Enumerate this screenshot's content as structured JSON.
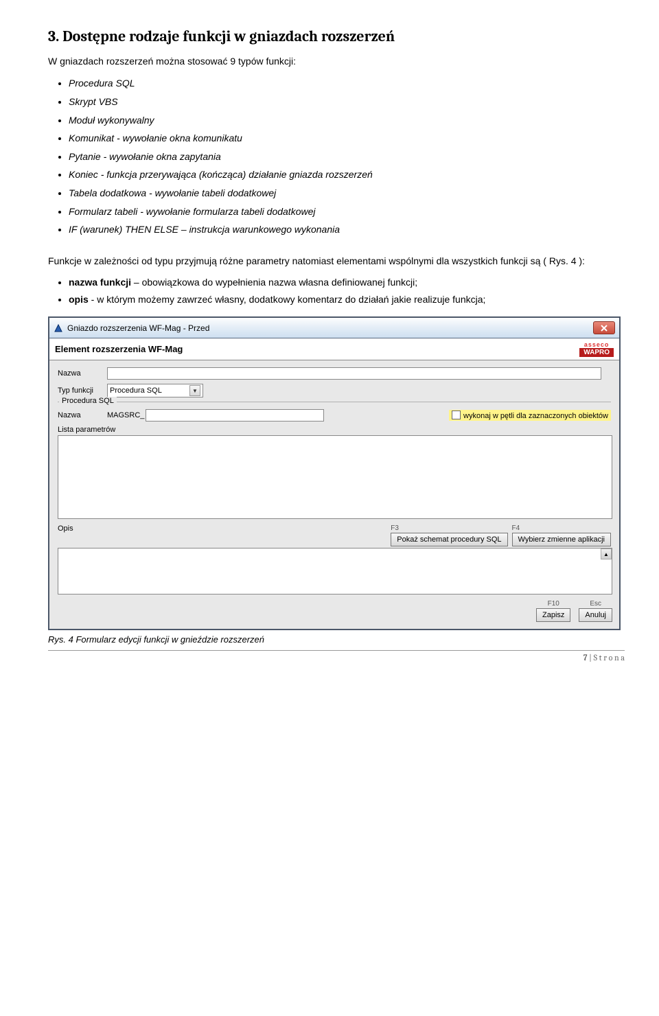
{
  "heading": "3. Dostępne rodzaje funkcji w gniazdach rozszerzeń",
  "intro": "W gniazdach rozszerzeń można stosować 9 typów funkcji:",
  "func_types": [
    "Procedura SQL",
    "Skrypt VBS",
    "Moduł wykonywalny",
    "Komunikat  - wywołanie okna komunikatu",
    "Pytanie  - wywołanie okna zapytania",
    "Koniec  - funkcja przerywająca (kończąca) działanie gniazda rozszerzeń",
    "Tabela dodatkowa  - wywołanie tabeli dodatkowej",
    "Formularz tabeli - wywołanie formularza tabeli dodatkowej",
    "IF (warunek) THEN ELSE – instrukcja warunkowego wykonania"
  ],
  "para1": "Funkcje w zależności od typu przyjmują różne parametry natomiast elementami wspólnymi  dla wszystkich funkcji są ( Rys. 4 ):",
  "bullets": [
    {
      "b": "nazwa funkcji",
      "rest": " – obowiązkowa do wypełnienia nazwa własna definiowanej funkcji;"
    },
    {
      "b": "opis",
      "rest": "  - w którym możemy zawrzeć własny, dodatkowy komentarz do działań jakie realizuje funkcja;"
    }
  ],
  "dialog": {
    "title": "Gniazdo rozszerzenia WF-Mag - Przed",
    "subhead": "Element rozszerzenia WF-Mag",
    "brand_top": "asseco",
    "brand_bottom": "WAPRO",
    "labels": {
      "nazwa": "Nazwa",
      "typ": "Typ funkcji",
      "group": "Procedura SQL",
      "nazwa2": "Nazwa",
      "prefix": "MAGSRC_",
      "loop": "wykonaj w pętli dla zaznaczonych obiektów",
      "lista": "Lista parametrów",
      "opis": "Opis"
    },
    "typ_value": "Procedura SQL",
    "buttons": {
      "f3": "F3",
      "f3_label": "Pokaż schemat procedury SQL",
      "f4": "F4",
      "f4_label": "Wybierz zmienne aplikacji",
      "f10": "F10",
      "zapisz": "Zapisz",
      "esc": "Esc",
      "anuluj": "Anuluj"
    }
  },
  "caption": "Rys. 4  Formularz edycji funkcji w gnieździe rozszerzeń",
  "page": {
    "num": "7",
    "suf": " | S t r o n a"
  }
}
